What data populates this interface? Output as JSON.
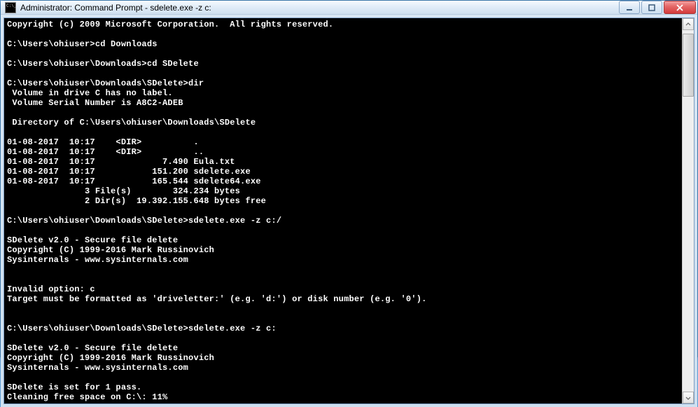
{
  "window": {
    "title": "Administrator: Command Prompt - sdelete.exe  -z c:"
  },
  "console": {
    "lines": [
      "Copyright (c) 2009 Microsoft Corporation.  All rights reserved.",
      "",
      "C:\\Users\\ohiuser>cd Downloads",
      "",
      "C:\\Users\\ohiuser\\Downloads>cd SDelete",
      "",
      "C:\\Users\\ohiuser\\Downloads\\SDelete>dir",
      " Volume in drive C has no label.",
      " Volume Serial Number is A8C2-ADEB",
      "",
      " Directory of C:\\Users\\ohiuser\\Downloads\\SDelete",
      "",
      "01-08-2017  10:17    <DIR>          .",
      "01-08-2017  10:17    <DIR>          ..",
      "01-08-2017  10:17             7.490 Eula.txt",
      "01-08-2017  10:17           151.200 sdelete.exe",
      "01-08-2017  10:17           165.544 sdelete64.exe",
      "               3 File(s)        324.234 bytes",
      "               2 Dir(s)  19.392.155.648 bytes free",
      "",
      "C:\\Users\\ohiuser\\Downloads\\SDelete>sdelete.exe -z c:/",
      "",
      "SDelete v2.0 - Secure file delete",
      "Copyright (C) 1999-2016 Mark Russinovich",
      "Sysinternals - www.sysinternals.com",
      "",
      "",
      "Invalid option: c",
      "Target must be formatted as 'driveletter:' (e.g. 'd:') or disk number (e.g. '0').",
      "",
      "",
      "C:\\Users\\ohiuser\\Downloads\\SDelete>sdelete.exe -z c:",
      "",
      "SDelete v2.0 - Secure file delete",
      "Copyright (C) 1999-2016 Mark Russinovich",
      "Sysinternals - www.sysinternals.com",
      "",
      "SDelete is set for 1 pass.",
      "Cleaning free space on C:\\: 11%"
    ]
  }
}
